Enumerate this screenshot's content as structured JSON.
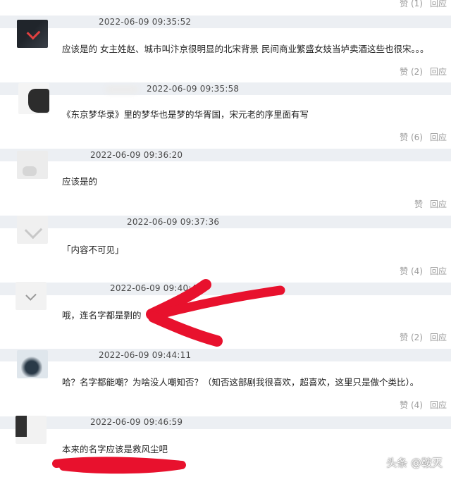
{
  "top_actions": {
    "like": "赞 (1)",
    "reply": "回应"
  },
  "comments": [
    {
      "time": "2022-06-09 09:35:52",
      "text": "应该是的 女主姓赵、城市叫汴京很明显的北宋背景 民间商业繁盛女妓当垆卖酒这些也很宋。。。",
      "like": "赞 (2)",
      "reply": "回应"
    },
    {
      "time": "2022-06-09 09:35:58",
      "text": "《东京梦华录》里的梦华也是梦的华胥国，宋元老的序里面有写",
      "like": "赞 (6)",
      "reply": "回应"
    },
    {
      "time": "2022-06-09 09:36:20",
      "text": "应该是的",
      "like": "赞",
      "reply": "回应"
    },
    {
      "time": "2022-06-09 09:37:36",
      "text": "「内容不可见」",
      "like": "赞 (4)",
      "reply": "回应"
    },
    {
      "time": "2022-06-09 09:40:46",
      "text": "哦，连名字都是剽的",
      "like": "赞 (2)",
      "reply": "回应"
    },
    {
      "time": "2022-06-09 09:44:11",
      "text": "哈？名字都能嘲？为啥没人嘲知否？（知否这部剧我很喜欢，超喜欢，这里只是做个类比）。",
      "like": "赞 (4)",
      "reply": "回应"
    },
    {
      "time": "2022-06-09 09:46:59",
      "text": "本来的名字应该是救风尘吧"
    }
  ],
  "watermark": "头条 @鞍灭",
  "colors": {
    "stripe": "#eceff3",
    "annotation": "#e8112d",
    "action_text": "#9a9a9a"
  }
}
